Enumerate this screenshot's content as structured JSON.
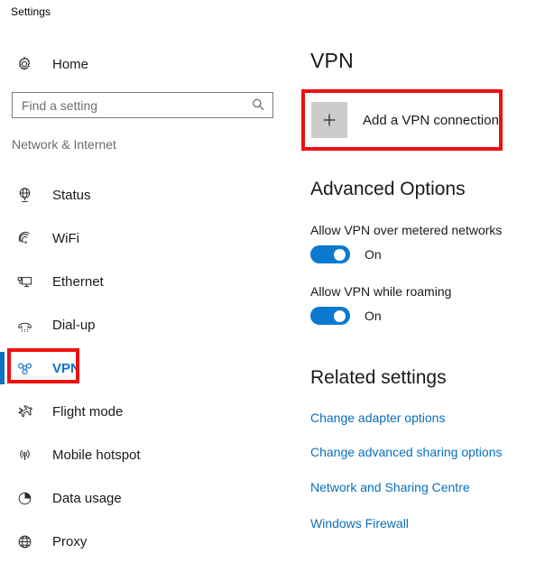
{
  "window": {
    "title": "Settings"
  },
  "sidebar": {
    "home": {
      "label": "Home",
      "icon": "gear-icon"
    },
    "search": {
      "value": "",
      "placeholder": "Find a setting",
      "icon": "search-icon"
    },
    "category": "Network & Internet",
    "items": [
      {
        "label": "Status",
        "icon": "status-globe-icon",
        "selected": false
      },
      {
        "label": "WiFi",
        "icon": "wifi-icon",
        "selected": false
      },
      {
        "label": "Ethernet",
        "icon": "ethernet-icon",
        "selected": false
      },
      {
        "label": "Dial-up",
        "icon": "dialup-phone-icon",
        "selected": false
      },
      {
        "label": "VPN",
        "icon": "vpn-hub-icon",
        "selected": true
      },
      {
        "label": "Flight mode",
        "icon": "airplane-icon",
        "selected": false
      },
      {
        "label": "Mobile hotspot",
        "icon": "hotspot-icon",
        "selected": false
      },
      {
        "label": "Data usage",
        "icon": "pie-chart-icon",
        "selected": false
      },
      {
        "label": "Proxy",
        "icon": "globe-icon",
        "selected": false
      }
    ]
  },
  "main": {
    "page_title": "VPN",
    "add_connection": {
      "label": "Add a VPN connection",
      "icon": "plus-icon"
    },
    "advanced_options": {
      "heading": "Advanced Options",
      "options": [
        {
          "label": "Allow VPN over metered networks",
          "state": "On"
        },
        {
          "label": "Allow VPN while roaming",
          "state": "On"
        }
      ]
    },
    "related_settings": {
      "heading": "Related settings",
      "links": [
        "Change adapter options",
        "Change advanced sharing options",
        "Network and Sharing Centre",
        "Windows Firewall"
      ]
    }
  },
  "annotations": {
    "color": "#ee1111",
    "boxes": [
      "add-vpn-connection-button",
      "sidebar-item-vpn"
    ]
  },
  "colors": {
    "accent": "#0a70c8",
    "toggle_on": "#0c79d0",
    "link": "#0a6ebd",
    "annotation": "#ee1111",
    "plus_tile": "#cccccc"
  }
}
